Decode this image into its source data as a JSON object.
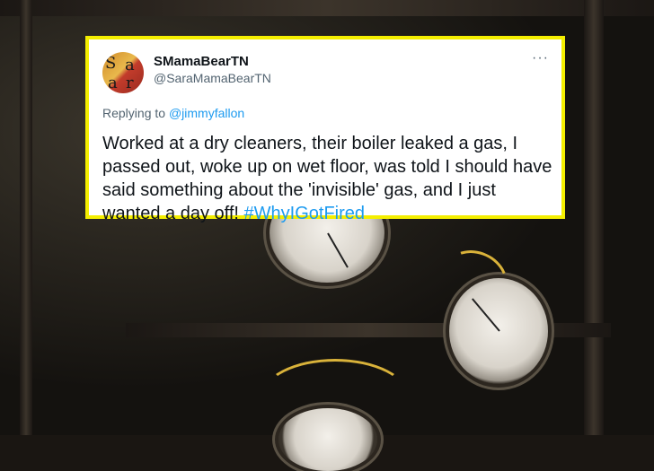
{
  "tweet": {
    "display_name": "SMamaBearTN",
    "handle": "@SaraMamaBearTN",
    "more_glyph": "···",
    "replying_prefix": "Replying to",
    "replying_to": "@jimmyfallon",
    "body": "Worked at a dry cleaners, their boiler leaked a gas, I passed out, woke up on wet floor, was told I should have said something about the 'invisible' gas, and I just wanted a day off!",
    "hashtag": "#WhyIGotFired",
    "avatar_letters": [
      "S",
      "a",
      "a",
      "r"
    ]
  },
  "colors": {
    "highlight_border": "#f4ee00",
    "link": "#1d9bf0",
    "text": "#0f1419",
    "muted": "#536471"
  }
}
